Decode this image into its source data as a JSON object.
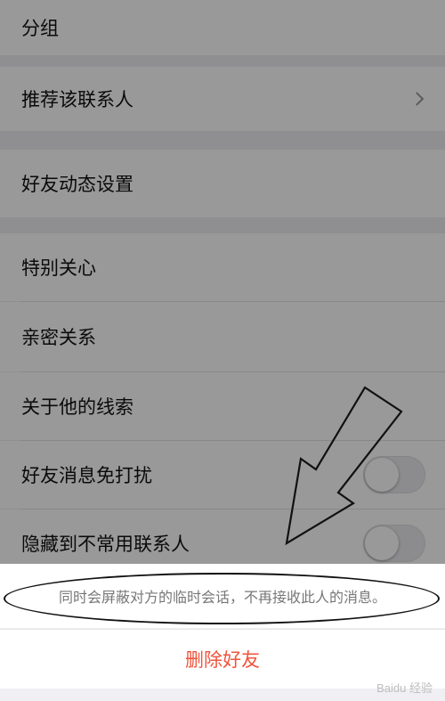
{
  "settings": {
    "group_label": "分组",
    "recommend_label": "推荐该联系人",
    "feed_settings_label": "好友动态设置",
    "special_care_label": "特别关心",
    "intimacy_label": "亲密关系",
    "clues_label": "关于他的线索",
    "mute_label": "好友消息免打扰",
    "hide_label": "隐藏到不常用联系人"
  },
  "toggles": {
    "mute_on": false,
    "hide_on": false
  },
  "sheet": {
    "message": "同时会屏蔽对方的临时会话，不再接收此人的消息。",
    "delete_label": "删除好友"
  },
  "watermark": "Baidu 经验",
  "colors": {
    "delete_red": "#f0543c",
    "annotation": "#111111"
  }
}
